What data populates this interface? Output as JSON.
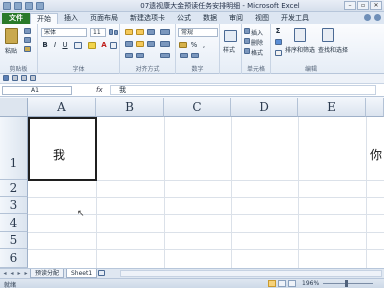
{
  "window": {
    "title": "07遗视康大金预读任务安排明细 - Microsoft Excel",
    "qat_icons": [
      "excel-icon",
      "save-icon",
      "undo-icon",
      "redo-icon"
    ],
    "controls": [
      "minimize-icon",
      "restore-icon",
      "close-icon"
    ],
    "control_glyphs": [
      "–",
      "▫",
      "✕"
    ]
  },
  "tabs": [
    "文件",
    "开始",
    "插入",
    "页面布局",
    "新建选项卡",
    "公式",
    "数据",
    "审阅",
    "视图",
    "开发工具"
  ],
  "ribbon": {
    "clipboard": {
      "paste": "粘贴",
      "label": "剪贴板"
    },
    "font": {
      "name": "宋体",
      "size": "11",
      "bold": "B",
      "italic": "I",
      "underline": "U",
      "font_color_label": "A",
      "label": "字体"
    },
    "alignment": {
      "label": "对齐方式"
    },
    "number": {
      "format": "常规",
      "percent": "%",
      "comma": ",",
      "label": "数字"
    },
    "styles": {
      "style": "样式",
      "label": ""
    },
    "cells": {
      "insert": "插入",
      "delete": "删除",
      "format": "格式",
      "label": "单元格"
    },
    "editing": {
      "sum": "Σ",
      "sort_filter": "排序和筛选",
      "find_select": "查找和选择",
      "label": "编辑"
    }
  },
  "formula_bar": {
    "name_box": "A1",
    "fx": "fx",
    "content": "我"
  },
  "grid": {
    "columns": [
      "A",
      "B",
      "C",
      "D",
      "E"
    ],
    "rows": [
      "1",
      "2",
      "3",
      "4",
      "5",
      "6"
    ],
    "cell_a1": "我",
    "cell_f1_partial": "你"
  },
  "sheet_tabs": {
    "nav": [
      "◂",
      "◂",
      "▸",
      "▸"
    ],
    "tabs": [
      "预读分配",
      "Sheet1"
    ],
    "active": "Sheet1"
  },
  "status": {
    "ready": "就绪",
    "zoom": "196%"
  }
}
